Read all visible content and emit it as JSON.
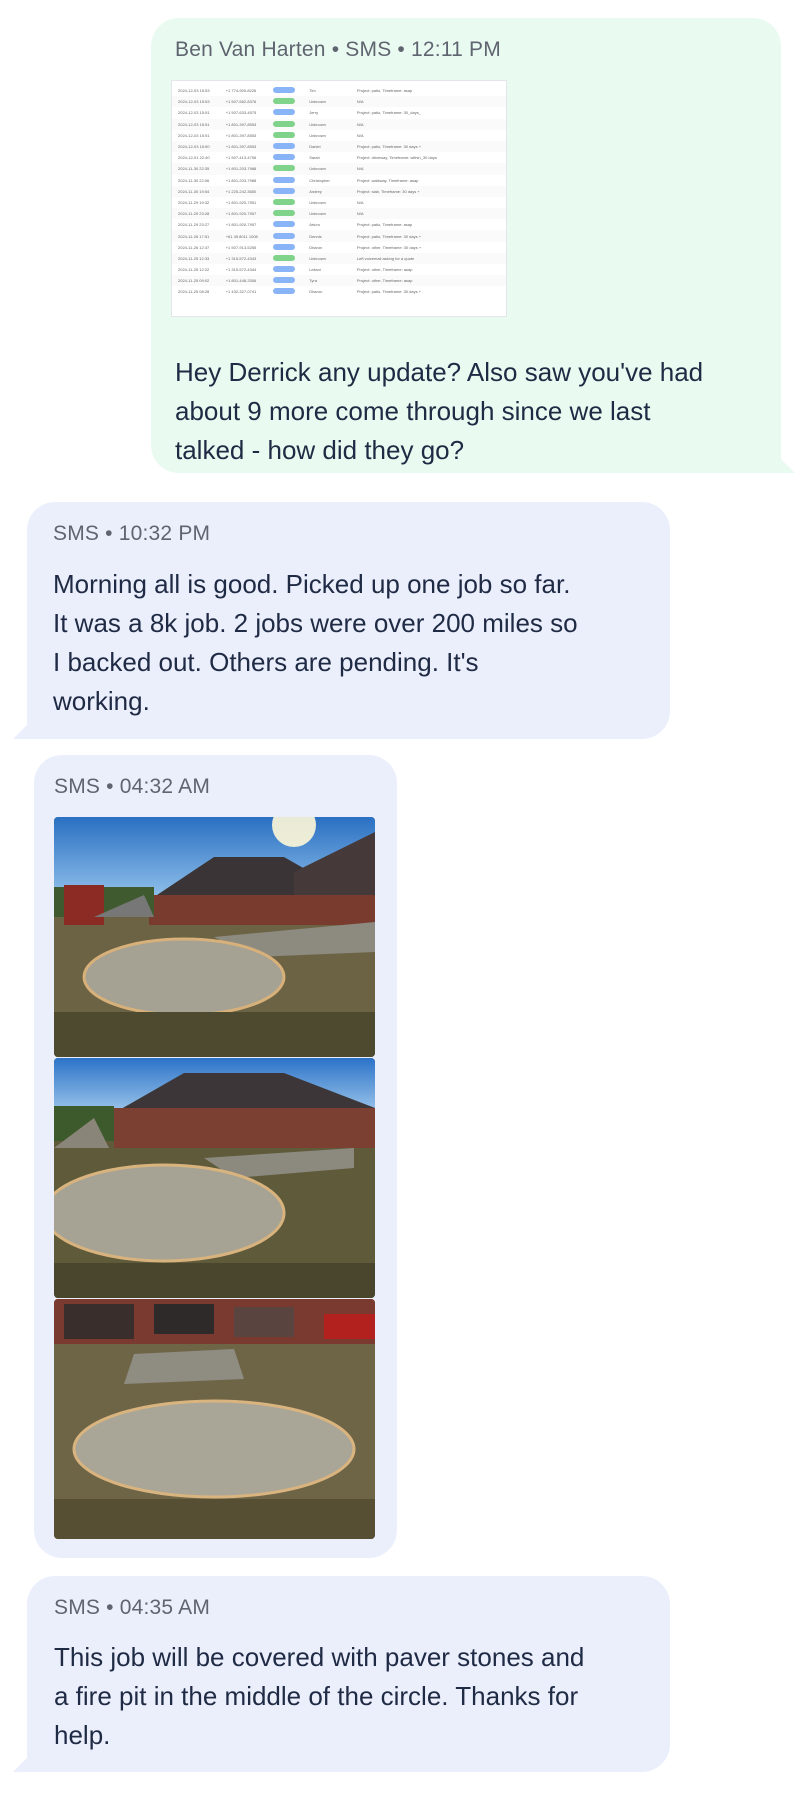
{
  "messages": [
    {
      "meta": "Ben Van Harten • SMS • 12:11 PM",
      "text": "Hey Derrick any update? Also saw you've had about 9 more come through since we last talked - how did they go?",
      "lines": [
        "Hey Derrick any update? Also saw you've had",
        "about 9 more come through since we last",
        "talked - how did they go?"
      ]
    },
    {
      "meta": "SMS • 10:32 PM",
      "lines": [
        "Morning all is good.  Picked up one job so far.",
        "It was a 8k job.  2 jobs were over  200 miles so",
        "I backed out.  Others are pending.    It's",
        "working."
      ]
    },
    {
      "meta": "SMS • 04:32 AM"
    },
    {
      "meta": "SMS • 04:35 AM",
      "lines": [
        "This job will be covered with paver stones and",
        "a fire pit in the middle of the circle.  Thanks for",
        "help."
      ]
    }
  ],
  "sheet": {
    "rows": [
      {
        "date": "2024-12-03 15:53",
        "phone": "+1 774-900-8226",
        "source": "Website",
        "name": "Tim",
        "notes": "Project: patio, Timeframe: asap"
      },
      {
        "date": "2024-12-03 15:53",
        "phone": "+1 507-562-8376",
        "source": "Phone Call",
        "name": "Unknown",
        "notes": "N/A"
      },
      {
        "date": "2024-12-03 15:51",
        "phone": "+1 507-633-4575",
        "source": "Website",
        "name": "Jerry",
        "notes": "Project: patio, Timeframe: 30_days_"
      },
      {
        "date": "2024-12-03 15:51",
        "phone": "+1 801-397-8553",
        "source": "Phone Call",
        "name": "Unknown",
        "notes": "N/A"
      },
      {
        "date": "2024-12-03 15:51",
        "phone": "+1 801-397-8553",
        "source": "Phone Call",
        "name": "Unknown",
        "notes": "N/A"
      },
      {
        "date": "2024-12-03 15:50",
        "phone": "+1 801-397-8553",
        "source": "Website",
        "name": "Daniel",
        "notes": "Project: patio, Timeframe: 30 days +"
      },
      {
        "date": "2024-12-01 22:40",
        "phone": "+1 507-413-4706",
        "source": "Website",
        "name": "Sarah",
        "notes": "Project: driveway, Timeframe: within_30 days"
      },
      {
        "date": "2024-11-30 22:35",
        "phone": "+1 801-203-7988",
        "source": "Phone Call",
        "name": "Unknown",
        "notes": "N/A"
      },
      {
        "date": "2024-11-30 22:06",
        "phone": "+1 801-203-7988",
        "source": "Website",
        "name": "Christopher",
        "notes": "Project: walkway, Timeframe: asap"
      },
      {
        "date": "2024-11-30 19:54",
        "phone": "+1 225-242-3650",
        "source": "Website",
        "name": "Andrey",
        "notes": "Project: slab, Timeframe: 30 days +"
      },
      {
        "date": "2024-11-29 19:32",
        "phone": "+1 801-920-7951",
        "source": "Phone Call",
        "name": "Unknown",
        "notes": "N/A"
      },
      {
        "date": "2024-11-29 23:28",
        "phone": "+1 801-920-7957",
        "source": "Phone Call",
        "name": "Unknown",
        "notes": "N/A"
      },
      {
        "date": "2024-11-29 23:27",
        "phone": "+1 801-920-7957",
        "source": "Website",
        "name": "Arturo",
        "notes": "Project: patio, Timeframe: asap"
      },
      {
        "date": "2024-11-26 17:51",
        "phone": "+61 45 8011 1008",
        "source": "Website",
        "name": "Dennis",
        "notes": "Project: patio, Timeframe: 30 days +"
      },
      {
        "date": "2024-11-26 12:37",
        "phone": "+1 507-913-5255",
        "source": "Website",
        "name": "Dharon",
        "notes": "Project: other, Timeframe: 30 days +"
      },
      {
        "date": "2024-11-25 12:33",
        "phone": "+1 315-572-4343",
        "source": "Phone Call",
        "name": "Unknown",
        "notes": "Left voicemail asking for a quote"
      },
      {
        "date": "2024-11-25 12:22",
        "phone": "+1 315-572-4344",
        "source": "Website",
        "name": "Leilani",
        "notes": "Project: other, Timeframe: asap"
      },
      {
        "date": "2024-11-25 09:02",
        "phone": "+1 801-448-3306",
        "source": "Website",
        "name": "Tyra",
        "notes": "Project: other, Timeframe: asap"
      },
      {
        "date": "2024-11-25 08:28",
        "phone": "+1 432-327-0741",
        "source": "Website",
        "name": "Dharon",
        "notes": "Project: patio, Timeframe: 30 days +"
      }
    ]
  },
  "colors": {
    "outgoing_bubble": "#e9fbf0",
    "incoming_bubble": "#ebeffc",
    "website_pill": "#8ab4f8",
    "phone_call_pill": "#7fd38a"
  }
}
